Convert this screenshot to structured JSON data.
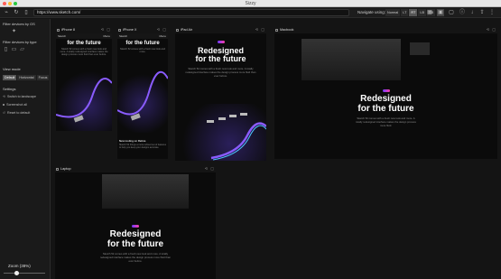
{
  "app": {
    "title": "Sizzy"
  },
  "toolbar": {
    "url": "https://www.sketch.com/",
    "navigate_label": "Navigate using:",
    "nav_modes": [
      "Normal",
      "LT",
      "RT",
      "LB",
      "RB"
    ],
    "nav_active": "LT"
  },
  "sidebar": {
    "filter_os_title": "Filter devices by OS",
    "filter_type_title": "Filter devices by type",
    "view_mode_title": "View mode",
    "view_modes": [
      "Default",
      "Horizontal",
      "Focus"
    ],
    "view_mode_active": "Default",
    "settings_title": "Settings",
    "settings": [
      "Switch to landscape",
      "Screenshot all",
      "Reset to default"
    ],
    "zoom_label": "Zoom",
    "zoom_value": "(38%)",
    "zoom_fraction": 0.38
  },
  "devices": {
    "iphone8": {
      "name": "iPhone 8",
      "brand": "Sketch",
      "menu": "Menu",
      "headline": "for the future",
      "body": "Sketch 52 comes with a fresh new look and more. A totally redesigned interface makes the design process more fluid than ever before."
    },
    "iphonex": {
      "name": "iPhone X",
      "brand": "Sketch",
      "menu": "Menu",
      "headline": "for the future",
      "body": "Sketch 52 comes with a fresh new look and more.",
      "bottom_title": "New tooling on Retina",
      "bottom_body": "Sketch 52 brings a more refined set of features to help you keep your designs accurate."
    },
    "ipadair": {
      "name": "iPad Air",
      "headline1": "Redesigned",
      "headline2": "for the future",
      "body": "Sketch 52 comes with a fresh new look and more. A totally redesigned interface makes the design process more fluid than ever before."
    },
    "macbook": {
      "name": "Macbook",
      "headline1": "Redesigned",
      "headline2": "for the future",
      "body": "Sketch 52 comes with a fresh new look and more. A totally redesigned interface makes the design process more fluid."
    },
    "laptop": {
      "name": "Laptop",
      "headline1": "Redesigned",
      "headline2": "for the future",
      "body": "Sketch 52 comes with a fresh new look and more. A totally redesigned interface makes the design process more fluid than ever before."
    }
  },
  "icons": [
    "traffic-lights",
    "refresh-icon",
    "back-icon",
    "mobile-icon",
    "apple-icon",
    "android-icon",
    "phone-icon",
    "tablet-icon",
    "laptop-icon",
    "rotate-icon",
    "camera-icon",
    "reset-icon",
    "zoom-icon"
  ]
}
